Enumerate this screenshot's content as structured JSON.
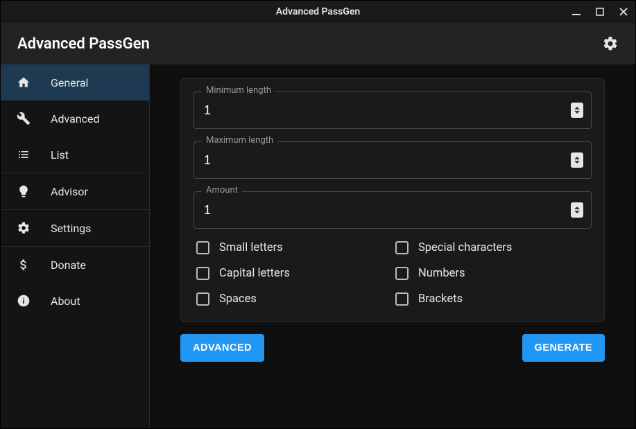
{
  "window": {
    "title": "Advanced PassGen"
  },
  "appbar": {
    "title": "Advanced PassGen"
  },
  "sidebar": {
    "items": [
      {
        "label": "General"
      },
      {
        "label": "Advanced"
      },
      {
        "label": "List"
      },
      {
        "label": "Advisor"
      },
      {
        "label": "Settings"
      },
      {
        "label": "Donate"
      },
      {
        "label": "About"
      }
    ]
  },
  "fields": {
    "min": {
      "label": "Minimum length",
      "value": "1"
    },
    "max": {
      "label": "Maximum length",
      "value": "1"
    },
    "amount": {
      "label": "Amount",
      "value": "1"
    }
  },
  "checks": {
    "small": "Small letters",
    "special": "Special characters",
    "capital": "Capital letters",
    "numbers": "Numbers",
    "spaces": "Spaces",
    "brackets": "Brackets"
  },
  "buttons": {
    "advanced": "ADVANCED",
    "generate": "GENERATE"
  }
}
